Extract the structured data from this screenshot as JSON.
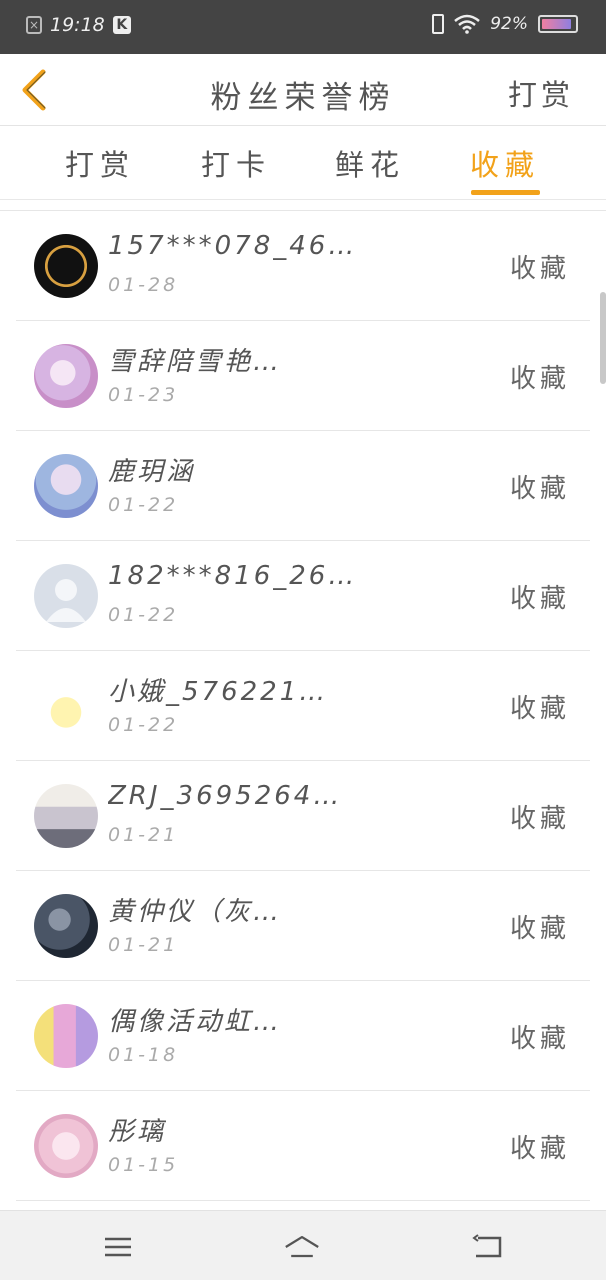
{
  "status_bar": {
    "time": "19:18",
    "k_badge": "K",
    "battery": "92%",
    "battery_level": 0.92,
    "icons": [
      "notification-box-icon",
      "k-app-icon",
      "vibrate-icon",
      "wifi-icon",
      "battery-icon"
    ]
  },
  "header": {
    "title": "粉丝荣誉榜",
    "right_action": "打赏",
    "back_icon": "chevron-left-icon"
  },
  "tabs": [
    {
      "label": "打赏",
      "active": false
    },
    {
      "label": "打卡",
      "active": false
    },
    {
      "label": "鲜花",
      "active": false
    },
    {
      "label": "收藏",
      "active": true
    }
  ],
  "accent_color": "#f2a21a",
  "fans": [
    {
      "name": "157***078_46…",
      "date": "01-28",
      "action": "收藏"
    },
    {
      "name": "雪辞陪雪艳…",
      "date": "01-23",
      "action": "收藏"
    },
    {
      "name": "鹿玥涵",
      "date": "01-22",
      "action": "收藏"
    },
    {
      "name": "182***816_26…",
      "date": "01-22",
      "action": "收藏"
    },
    {
      "name": "小娥_576221…",
      "date": "01-22",
      "action": "收藏"
    },
    {
      "name": "ZRJ_3695264…",
      "date": "01-21",
      "action": "收藏"
    },
    {
      "name": "黄仲仪（灰…",
      "date": "01-21",
      "action": "收藏"
    },
    {
      "name": "偶像活动虹…",
      "date": "01-18",
      "action": "收藏"
    },
    {
      "name": "彤璃",
      "date": "01-15",
      "action": "收藏"
    }
  ],
  "nav_bar": {
    "icons": [
      "menu-icon",
      "home-icon",
      "back-icon"
    ]
  }
}
